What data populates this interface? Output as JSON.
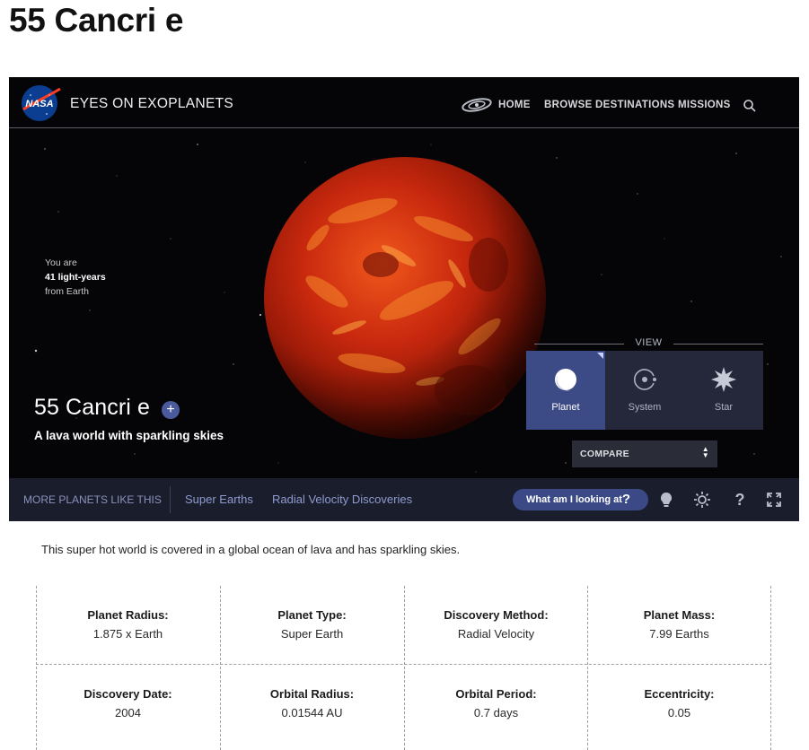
{
  "page": {
    "title": "55 Cancri e"
  },
  "app": {
    "name": "EYES ON EXOPLANETS",
    "nav": [
      "HOME",
      "BROWSE DESTINATIONS",
      "MISSIONS"
    ],
    "distance": {
      "line1": "You are",
      "line2": "41 light-years",
      "line3": "from Earth"
    },
    "planet_name": "55 Cancri e",
    "tagline": "A lava world with sparkling skies",
    "view": {
      "label": "VIEW",
      "options": [
        {
          "label": "Planet",
          "active": true
        },
        {
          "label": "System",
          "active": false
        },
        {
          "label": "Star",
          "active": false
        }
      ]
    },
    "compare_label": "COMPARE",
    "bottom": {
      "more_label": "MORE PLANETS LIKE THIS",
      "links": [
        "Super Earths",
        "Radial Velocity Discoveries"
      ],
      "looking_label": "What am I looking at"
    },
    "colors": {
      "accent": "#3c4a86",
      "panel": "#25283a",
      "bar": "#1a1d2b"
    }
  },
  "description": "This super hot world is covered in a global ocean of lava and has sparkling skies.",
  "stats": [
    {
      "label": "Planet Radius:",
      "value": "1.875 x Earth"
    },
    {
      "label": "Planet Type:",
      "value": "Super Earth"
    },
    {
      "label": "Discovery Method:",
      "value": "Radial Velocity"
    },
    {
      "label": "Planet Mass:",
      "value": "7.99 Earths"
    },
    {
      "label": "Discovery Date:",
      "value": "2004"
    },
    {
      "label": "Orbital Radius:",
      "value": "0.01544 AU"
    },
    {
      "label": "Orbital Period:",
      "value": "0.7 days"
    },
    {
      "label": "Eccentricity:",
      "value": "0.05"
    }
  ]
}
